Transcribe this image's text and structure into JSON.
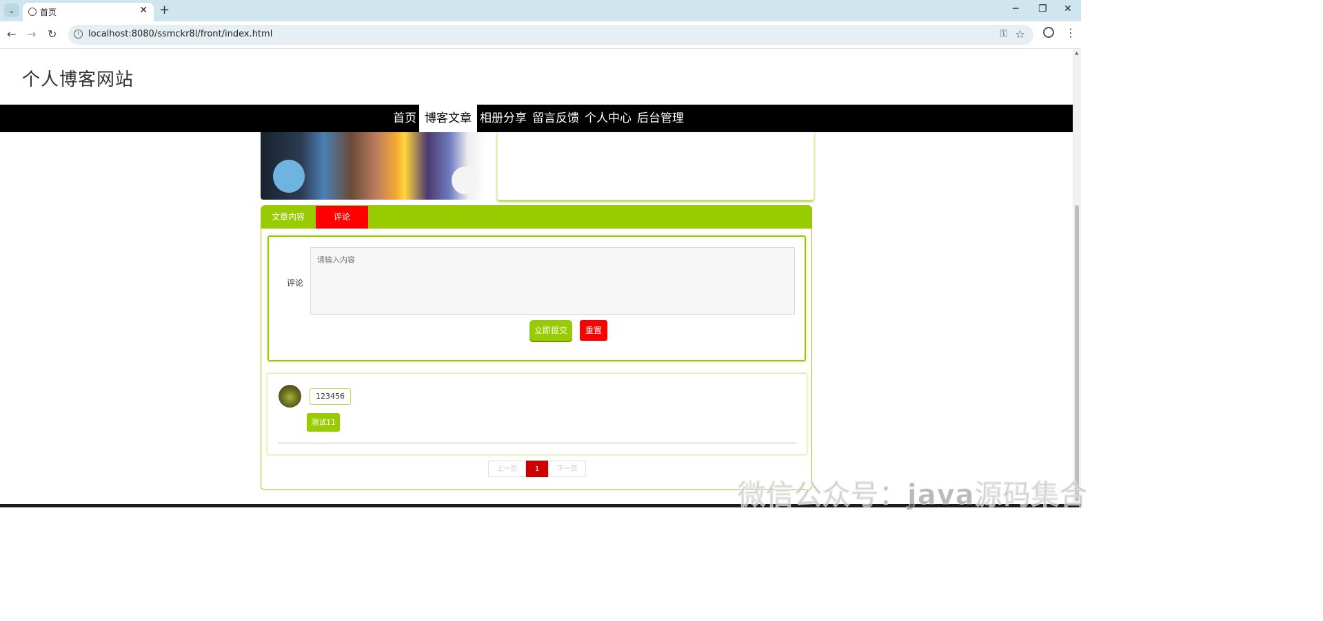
{
  "browser": {
    "tab_title": "首页",
    "tab_dropdown_icon": "⌄",
    "tab_close": "✕",
    "new_tab": "+",
    "minimize": "─",
    "restore": "❐",
    "close": "✕",
    "back": "←",
    "forward": "→",
    "reload": "↻",
    "url": "localhost:8080/ssmckr8l/front/index.html",
    "password_icon": "⚿",
    "bookmark_icon": "☆",
    "menu_icon": "⋮"
  },
  "site": {
    "title": "个人博客网站"
  },
  "nav": {
    "items": [
      "首页",
      "博客文章",
      "相册分享",
      "留言反馈",
      "个人中心",
      "后台管理"
    ],
    "active": "博客文章"
  },
  "tabs": {
    "content": "文章内容",
    "comment": "评论"
  },
  "form": {
    "label": "评论",
    "placeholder": "请输入内容",
    "submit": "立即提交",
    "reset": "重置"
  },
  "comments": [
    {
      "username": "123456",
      "text": "测试11"
    }
  ],
  "pagination": {
    "prev": "上一页",
    "current": "1",
    "next": "下一页"
  },
  "watermark": "微信公众号：java源码集合",
  "colors": {
    "accent": "#99cc00",
    "danger": "#ff0000",
    "nav_bg": "#000000"
  }
}
